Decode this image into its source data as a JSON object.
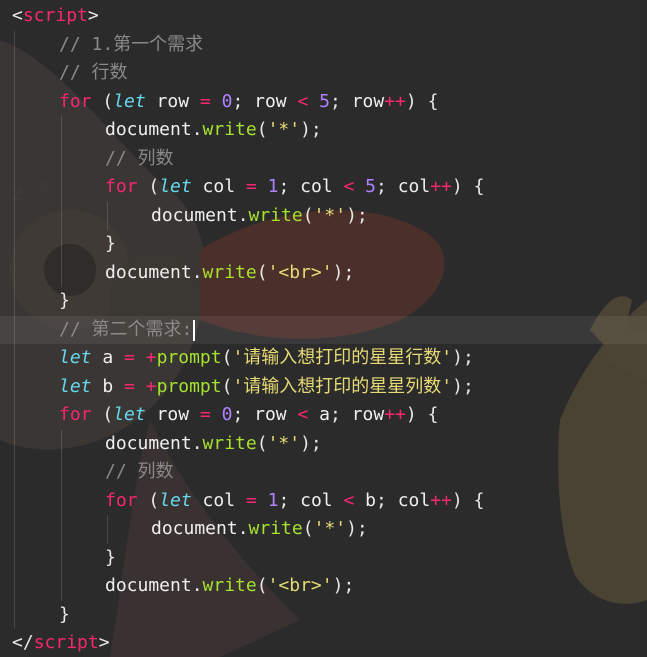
{
  "editor": {
    "language": "javascript",
    "colors": {
      "background": "#2b2b2b",
      "tag": "#f92672",
      "keyword": "#f92672",
      "storage": "#66d9ef",
      "number": "#ae81ff",
      "function": "#a6e22e",
      "string": "#e6db74",
      "comment": "#8a8a8a",
      "text": "#f0f0f0"
    },
    "lines": [
      {
        "indent": 0,
        "tokens": [
          {
            "t": "punct",
            "v": "<"
          },
          {
            "t": "tag",
            "v": "script"
          },
          {
            "t": "punct",
            "v": ">"
          }
        ]
      },
      {
        "indent": 1,
        "tokens": [
          {
            "t": "comment",
            "v": "// 1.第一个需求"
          }
        ]
      },
      {
        "indent": 1,
        "tokens": [
          {
            "t": "comment",
            "v": "// 行数"
          }
        ]
      },
      {
        "indent": 1,
        "tokens": [
          {
            "t": "keyword",
            "v": "for"
          },
          {
            "t": "punct",
            "v": " ("
          },
          {
            "t": "storage",
            "v": "let"
          },
          {
            "t": "ident",
            "v": " row "
          },
          {
            "t": "op",
            "v": "="
          },
          {
            "t": "punct",
            "v": " "
          },
          {
            "t": "num",
            "v": "0"
          },
          {
            "t": "punct",
            "v": "; "
          },
          {
            "t": "ident",
            "v": "row "
          },
          {
            "t": "op",
            "v": "<"
          },
          {
            "t": "punct",
            "v": " "
          },
          {
            "t": "num",
            "v": "5"
          },
          {
            "t": "punct",
            "v": "; "
          },
          {
            "t": "ident",
            "v": "row"
          },
          {
            "t": "op",
            "v": "++"
          },
          {
            "t": "punct",
            "v": ") {"
          }
        ]
      },
      {
        "indent": 2,
        "tokens": [
          {
            "t": "ident",
            "v": "document"
          },
          {
            "t": "punct",
            "v": "."
          },
          {
            "t": "func",
            "v": "write"
          },
          {
            "t": "punct",
            "v": "("
          },
          {
            "t": "string",
            "v": "'*'"
          },
          {
            "t": "punct",
            "v": ");"
          }
        ]
      },
      {
        "indent": 2,
        "tokens": [
          {
            "t": "comment",
            "v": "// 列数"
          }
        ]
      },
      {
        "indent": 2,
        "tokens": [
          {
            "t": "keyword",
            "v": "for"
          },
          {
            "t": "punct",
            "v": " ("
          },
          {
            "t": "storage",
            "v": "let"
          },
          {
            "t": "ident",
            "v": " col "
          },
          {
            "t": "op",
            "v": "="
          },
          {
            "t": "punct",
            "v": " "
          },
          {
            "t": "num",
            "v": "1"
          },
          {
            "t": "punct",
            "v": "; "
          },
          {
            "t": "ident",
            "v": "col "
          },
          {
            "t": "op",
            "v": "<"
          },
          {
            "t": "punct",
            "v": " "
          },
          {
            "t": "num",
            "v": "5"
          },
          {
            "t": "punct",
            "v": "; "
          },
          {
            "t": "ident",
            "v": "col"
          },
          {
            "t": "op",
            "v": "++"
          },
          {
            "t": "punct",
            "v": ") {"
          }
        ]
      },
      {
        "indent": 3,
        "tokens": [
          {
            "t": "ident",
            "v": "document"
          },
          {
            "t": "punct",
            "v": "."
          },
          {
            "t": "func",
            "v": "write"
          },
          {
            "t": "punct",
            "v": "("
          },
          {
            "t": "string",
            "v": "'*'"
          },
          {
            "t": "punct",
            "v": ");"
          }
        ]
      },
      {
        "indent": 2,
        "tokens": [
          {
            "t": "punct",
            "v": "}"
          }
        ]
      },
      {
        "indent": 2,
        "tokens": [
          {
            "t": "ident",
            "v": "document"
          },
          {
            "t": "punct",
            "v": "."
          },
          {
            "t": "func",
            "v": "write"
          },
          {
            "t": "punct",
            "v": "("
          },
          {
            "t": "string",
            "v": "'<br>'"
          },
          {
            "t": "punct",
            "v": ");"
          }
        ]
      },
      {
        "indent": 1,
        "tokens": [
          {
            "t": "punct",
            "v": "}"
          }
        ]
      },
      {
        "indent": 1,
        "cursor": true,
        "tokens": [
          {
            "t": "comment",
            "v": "// 第二个需求:"
          }
        ]
      },
      {
        "indent": 1,
        "tokens": [
          {
            "t": "storage",
            "v": "let"
          },
          {
            "t": "ident",
            "v": " a "
          },
          {
            "t": "op",
            "v": "="
          },
          {
            "t": "punct",
            "v": " "
          },
          {
            "t": "op",
            "v": "+"
          },
          {
            "t": "func",
            "v": "prompt"
          },
          {
            "t": "punct",
            "v": "("
          },
          {
            "t": "string",
            "v": "'请输入想打印的星星行数'"
          },
          {
            "t": "punct",
            "v": ");"
          }
        ]
      },
      {
        "indent": 1,
        "tokens": [
          {
            "t": "storage",
            "v": "let"
          },
          {
            "t": "ident",
            "v": " b "
          },
          {
            "t": "op",
            "v": "="
          },
          {
            "t": "punct",
            "v": " "
          },
          {
            "t": "op",
            "v": "+"
          },
          {
            "t": "func",
            "v": "prompt"
          },
          {
            "t": "punct",
            "v": "("
          },
          {
            "t": "string",
            "v": "'请输入想打印的星星列数'"
          },
          {
            "t": "punct",
            "v": ");"
          }
        ]
      },
      {
        "indent": 1,
        "tokens": [
          {
            "t": "keyword",
            "v": "for"
          },
          {
            "t": "punct",
            "v": " ("
          },
          {
            "t": "storage",
            "v": "let"
          },
          {
            "t": "ident",
            "v": " row "
          },
          {
            "t": "op",
            "v": "="
          },
          {
            "t": "punct",
            "v": " "
          },
          {
            "t": "num",
            "v": "0"
          },
          {
            "t": "punct",
            "v": "; "
          },
          {
            "t": "ident",
            "v": "row "
          },
          {
            "t": "op",
            "v": "<"
          },
          {
            "t": "punct",
            "v": " "
          },
          {
            "t": "ident",
            "v": "a"
          },
          {
            "t": "punct",
            "v": "; "
          },
          {
            "t": "ident",
            "v": "row"
          },
          {
            "t": "op",
            "v": "++"
          },
          {
            "t": "punct",
            "v": ") {"
          }
        ]
      },
      {
        "indent": 2,
        "tokens": [
          {
            "t": "ident",
            "v": "document"
          },
          {
            "t": "punct",
            "v": "."
          },
          {
            "t": "func",
            "v": "write"
          },
          {
            "t": "punct",
            "v": "("
          },
          {
            "t": "string",
            "v": "'*'"
          },
          {
            "t": "punct",
            "v": ");"
          }
        ]
      },
      {
        "indent": 2,
        "tokens": [
          {
            "t": "comment",
            "v": "// 列数"
          }
        ]
      },
      {
        "indent": 2,
        "tokens": [
          {
            "t": "keyword",
            "v": "for"
          },
          {
            "t": "punct",
            "v": " ("
          },
          {
            "t": "storage",
            "v": "let"
          },
          {
            "t": "ident",
            "v": " col "
          },
          {
            "t": "op",
            "v": "="
          },
          {
            "t": "punct",
            "v": " "
          },
          {
            "t": "num",
            "v": "1"
          },
          {
            "t": "punct",
            "v": "; "
          },
          {
            "t": "ident",
            "v": "col "
          },
          {
            "t": "op",
            "v": "<"
          },
          {
            "t": "punct",
            "v": " "
          },
          {
            "t": "ident",
            "v": "b"
          },
          {
            "t": "punct",
            "v": "; "
          },
          {
            "t": "ident",
            "v": "col"
          },
          {
            "t": "op",
            "v": "++"
          },
          {
            "t": "punct",
            "v": ") {"
          }
        ]
      },
      {
        "indent": 3,
        "tokens": [
          {
            "t": "ident",
            "v": "document"
          },
          {
            "t": "punct",
            "v": "."
          },
          {
            "t": "func",
            "v": "write"
          },
          {
            "t": "punct",
            "v": "("
          },
          {
            "t": "string",
            "v": "'*'"
          },
          {
            "t": "punct",
            "v": ");"
          }
        ]
      },
      {
        "indent": 2,
        "tokens": [
          {
            "t": "punct",
            "v": "}"
          }
        ]
      },
      {
        "indent": 2,
        "tokens": [
          {
            "t": "ident",
            "v": "document"
          },
          {
            "t": "punct",
            "v": "."
          },
          {
            "t": "func",
            "v": "write"
          },
          {
            "t": "punct",
            "v": "("
          },
          {
            "t": "string",
            "v": "'<br>'"
          },
          {
            "t": "punct",
            "v": ");"
          }
        ]
      },
      {
        "indent": 1,
        "tokens": [
          {
            "t": "punct",
            "v": "}"
          }
        ]
      },
      {
        "indent": 0,
        "tokens": [
          {
            "t": "punct",
            "v": "</"
          },
          {
            "t": "tag",
            "v": "script"
          },
          {
            "t": "punct",
            "v": ">"
          }
        ]
      }
    ]
  }
}
